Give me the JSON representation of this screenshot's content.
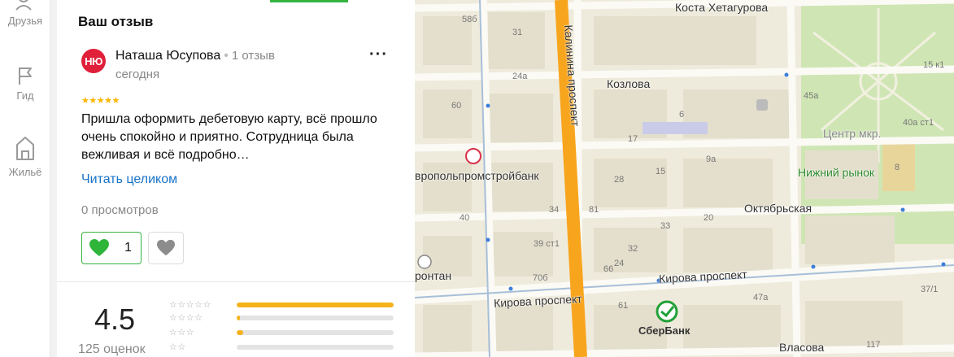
{
  "rail": {
    "friends_label": "Друзья",
    "guide_label": "Гид",
    "housing_label": "Жильё"
  },
  "review": {
    "section_title": "Ваш отзыв",
    "avatar_initials": "НЮ",
    "author_name": "Наташа Юсупова",
    "author_review_count": "1 отзыв",
    "date": "сегодня",
    "rating_stars": 5,
    "text": "Пришла оформить дебетовую карту, всё прошло очень спокойно и приятно. Сотрудница была вежливая и всё подробно…",
    "read_more": "Читать целиком",
    "views": "0 просмотров",
    "likes": "1",
    "colors": {
      "accent_green": "#35b43f",
      "avatar_red": "#e0203a",
      "star_yellow": "#ffb400",
      "link_blue": "#1a73c8"
    }
  },
  "rating": {
    "value": "4.5",
    "count_text": "125 оценок",
    "distribution": [
      {
        "stars": 5,
        "fraction": 1.0
      },
      {
        "stars": 4,
        "fraction": 0.02
      },
      {
        "stars": 3,
        "fraction": 0.04
      },
      {
        "stars": 2,
        "fraction": 0.0
      }
    ],
    "bar_color": "#f5b21a"
  },
  "map": {
    "streets": [
      "Коста Хетагурова",
      "Калинина проспект",
      "Козлова",
      "Октябрьская",
      "Кирова проспект",
      "Кирова проспект",
      "Власова"
    ],
    "places": [
      "Центр мкр.",
      "Нижний рынок",
      "вропольпромстройбанк",
      "ронтан",
      "СберБанк"
    ],
    "house_numbers": [
      "58б",
      "31",
      "24а",
      "60",
      "45а",
      "15 к1",
      "40а ст1",
      "6",
      "17",
      "9а",
      "15",
      "28",
      "8",
      "34",
      "81",
      "40",
      "33",
      "20",
      "39 ст1",
      "32",
      "24",
      "66",
      "70б",
      "47а",
      "37/1",
      "61",
      "117"
    ]
  }
}
